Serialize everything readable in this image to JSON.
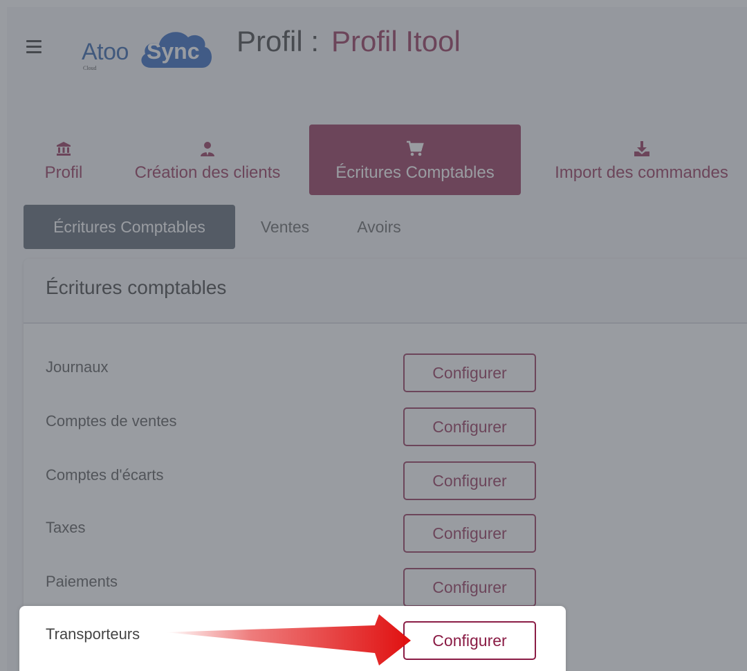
{
  "header": {
    "logo_text_atoo": "Atoo",
    "logo_text_sync": "Sync",
    "logo_text_cloud": "Cloud",
    "title_prefix": "Profil :",
    "profile_name": "Profil Itool"
  },
  "top_tabs": [
    {
      "label": "Profil",
      "icon": "bank-icon",
      "active": false
    },
    {
      "label": "Création des clients",
      "icon": "user-icon",
      "active": false
    },
    {
      "label": "Écritures Comptables",
      "icon": "cart-icon",
      "active": true
    },
    {
      "label": "Import des commandes",
      "icon": "download-icon",
      "active": false
    }
  ],
  "sub_tabs": [
    {
      "label": "Écritures Comptables",
      "active": true
    },
    {
      "label": "Ventes",
      "active": false
    },
    {
      "label": "Avoirs",
      "active": false
    }
  ],
  "card": {
    "title": "Écritures comptables",
    "rows": [
      {
        "label": "Journaux",
        "button": "Configurer"
      },
      {
        "label": "Comptes de ventes",
        "button": "Configurer"
      },
      {
        "label": "Comptes d'écarts",
        "button": "Configurer"
      },
      {
        "label": "Taxes",
        "button": "Configurer"
      },
      {
        "label": "Paiements",
        "button": "Configurer"
      }
    ],
    "highlighted_row": {
      "label": "Transporteurs",
      "button": "Configurer"
    }
  },
  "colors": {
    "brand": "#8a1c45",
    "logo_blue": "#1a4fa0",
    "subtab_active": "#4b5563",
    "arrow": "#e01010"
  }
}
